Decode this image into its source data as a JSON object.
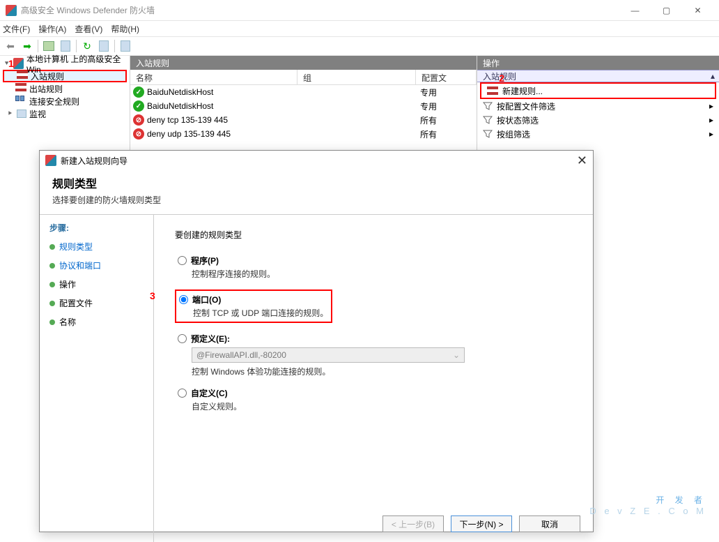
{
  "window": {
    "title": "高级安全 Windows Defender 防火墙"
  },
  "menu": {
    "file": "文件(F)",
    "action": "操作(A)",
    "view": "查看(V)",
    "help": "帮助(H)"
  },
  "tree": {
    "root": "本地计算机 上的高级安全 Win",
    "inbound": "入站规则",
    "outbound": "出站规则",
    "connection": "连接安全规则",
    "monitor": "监视"
  },
  "center": {
    "header": "入站规则",
    "cols": {
      "name": "名称",
      "group": "组",
      "profile": "配置文"
    },
    "rows": [
      {
        "name": "BaiduNetdiskHost",
        "group": "",
        "profile": "专用",
        "enabled": true
      },
      {
        "name": "BaiduNetdiskHost",
        "group": "",
        "profile": "专用",
        "enabled": true
      },
      {
        "name": "deny tcp 135-139 445",
        "group": "",
        "profile": "所有",
        "enabled": false
      },
      {
        "name": "deny udp 135-139 445",
        "group": "",
        "profile": "所有",
        "enabled": false
      }
    ]
  },
  "actions": {
    "header": "操作",
    "section": "入站规则",
    "new_rule": "新建规则...",
    "by_profile": "按配置文件筛选",
    "by_state": "按状态筛选",
    "by_group": "按组筛选"
  },
  "dialog": {
    "title": "新建入站规则向导",
    "heading": "规则类型",
    "subheading": "选择要创建的防火墙规则类型",
    "steps_label": "步骤:",
    "steps": {
      "rule_type": "规则类型",
      "protocol": "协议和端口",
      "action": "操作",
      "profile": "配置文件",
      "name": "名称"
    },
    "prompt": "要创建的规则类型",
    "options": {
      "program": {
        "label": "程序(P)",
        "desc": "控制程序连接的规则。"
      },
      "port": {
        "label": "端口(O)",
        "desc": "控制 TCP 或 UDP 端口连接的规则。"
      },
      "predefined": {
        "label": "预定义(E):",
        "combo": "@FirewallAPI.dll,-80200",
        "desc": "控制 Windows 体验功能连接的规则。"
      },
      "custom": {
        "label": "自定义(C)",
        "desc": "自定义规则。"
      }
    },
    "buttons": {
      "back": "< 上一步(B)",
      "next": "下一步(N) >",
      "cancel": "取消"
    }
  },
  "annotations": {
    "a1": "1",
    "a2": "2",
    "a3": "3"
  },
  "watermark": {
    "main": "开 发 者",
    "sub": "D e v Z E . C o M"
  }
}
